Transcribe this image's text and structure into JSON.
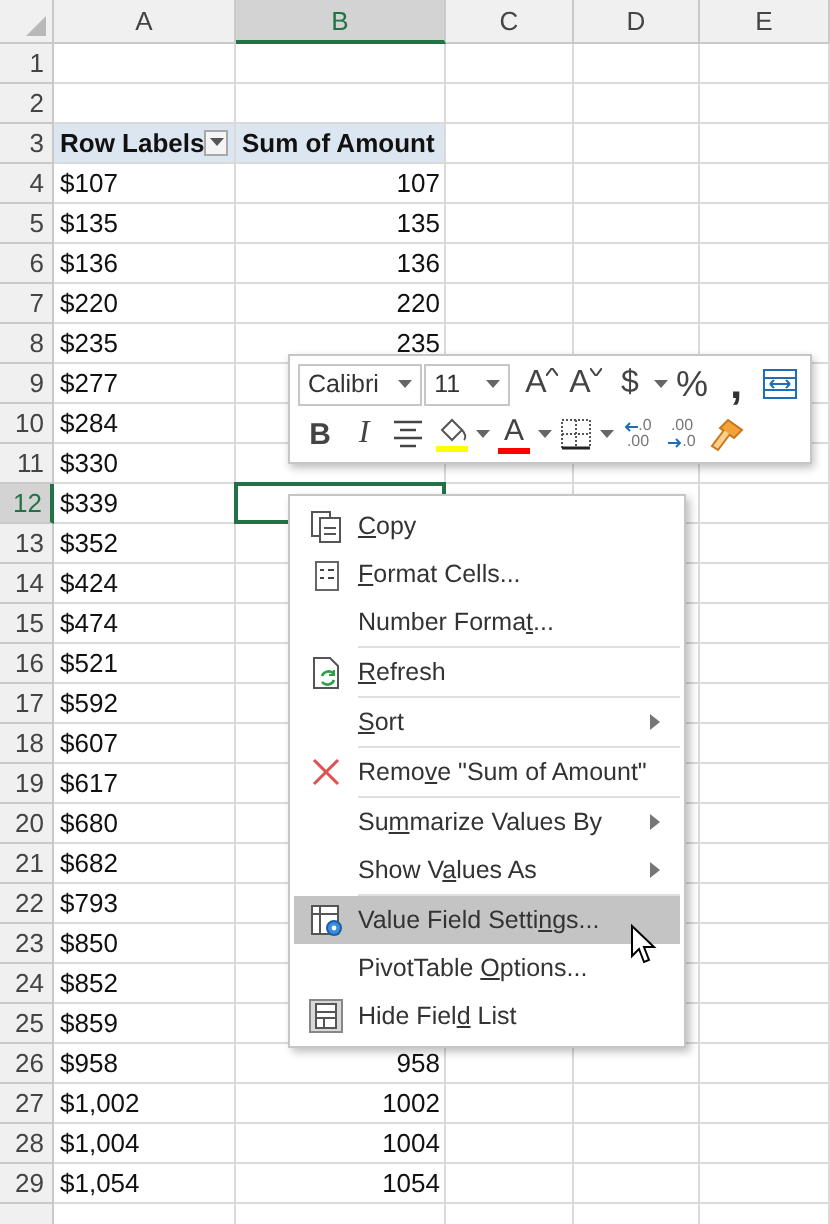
{
  "sheet": {
    "columns": [
      {
        "label": "A",
        "selected": false
      },
      {
        "label": "B",
        "selected": true
      },
      {
        "label": "C",
        "selected": false
      },
      {
        "label": "D",
        "selected": false
      },
      {
        "label": "E",
        "selected": false
      }
    ],
    "rows": [
      {
        "label": "1",
        "selected": false,
        "cells": []
      },
      {
        "label": "2",
        "selected": false,
        "cells": []
      },
      {
        "label": "3",
        "selected": false,
        "kind": "pivot-header",
        "cells": [
          {
            "text": "Row Labels",
            "filter": true
          },
          {
            "text": "Sum of Amount"
          }
        ]
      },
      {
        "label": "4",
        "selected": false,
        "cells": [
          {
            "text": "$107"
          },
          {
            "text": "107",
            "kind": "number"
          }
        ]
      },
      {
        "label": "5",
        "selected": false,
        "cells": [
          {
            "text": "$135"
          },
          {
            "text": "135",
            "kind": "number"
          }
        ]
      },
      {
        "label": "6",
        "selected": false,
        "cells": [
          {
            "text": "$136"
          },
          {
            "text": "136",
            "kind": "number"
          }
        ]
      },
      {
        "label": "7",
        "selected": false,
        "cells": [
          {
            "text": "$220"
          },
          {
            "text": "220",
            "kind": "number"
          }
        ]
      },
      {
        "label": "8",
        "selected": false,
        "cells": [
          {
            "text": "$235"
          },
          {
            "text": "235",
            "kind": "number"
          }
        ]
      },
      {
        "label": "9",
        "selected": false,
        "cells": [
          {
            "text": "$277"
          }
        ]
      },
      {
        "label": "10",
        "selected": false,
        "cells": [
          {
            "text": "$284"
          }
        ]
      },
      {
        "label": "11",
        "selected": false,
        "cells": [
          {
            "text": "$330"
          }
        ]
      },
      {
        "label": "12",
        "selected": true,
        "cells": [
          {
            "text": "$339"
          }
        ]
      },
      {
        "label": "13",
        "selected": false,
        "cells": [
          {
            "text": "$352"
          }
        ]
      },
      {
        "label": "14",
        "selected": false,
        "cells": [
          {
            "text": "$424"
          }
        ]
      },
      {
        "label": "15",
        "selected": false,
        "cells": [
          {
            "text": "$474"
          }
        ]
      },
      {
        "label": "16",
        "selected": false,
        "cells": [
          {
            "text": "$521"
          }
        ]
      },
      {
        "label": "17",
        "selected": false,
        "cells": [
          {
            "text": "$592"
          }
        ]
      },
      {
        "label": "18",
        "selected": false,
        "cells": [
          {
            "text": "$607"
          }
        ]
      },
      {
        "label": "19",
        "selected": false,
        "cells": [
          {
            "text": "$617"
          }
        ]
      },
      {
        "label": "20",
        "selected": false,
        "cells": [
          {
            "text": "$680"
          }
        ]
      },
      {
        "label": "21",
        "selected": false,
        "cells": [
          {
            "text": "$682"
          }
        ]
      },
      {
        "label": "22",
        "selected": false,
        "cells": [
          {
            "text": "$793"
          }
        ]
      },
      {
        "label": "23",
        "selected": false,
        "cells": [
          {
            "text": "$850"
          }
        ]
      },
      {
        "label": "24",
        "selected": false,
        "cells": [
          {
            "text": "$852"
          }
        ]
      },
      {
        "label": "25",
        "selected": false,
        "cells": [
          {
            "text": "$859"
          }
        ]
      },
      {
        "label": "26",
        "selected": false,
        "cells": [
          {
            "text": "$958"
          },
          {
            "text": "958",
            "kind": "number"
          }
        ]
      },
      {
        "label": "27",
        "selected": false,
        "cells": [
          {
            "text": "$1,002"
          },
          {
            "text": "1002",
            "kind": "number"
          }
        ]
      },
      {
        "label": "28",
        "selected": false,
        "cells": [
          {
            "text": "$1,004"
          },
          {
            "text": "1004",
            "kind": "number"
          }
        ]
      },
      {
        "label": "29",
        "selected": false,
        "cells": [
          {
            "text": "$1,054"
          },
          {
            "text": "1054",
            "kind": "number"
          }
        ]
      }
    ]
  },
  "mini_toolbar": {
    "top_tools": [
      {
        "kind": "font-name",
        "value": "Calibri"
      },
      {
        "kind": "font-size",
        "value": "11"
      },
      {
        "kind": "grow-font",
        "text": "A"
      },
      {
        "kind": "shrink-font",
        "text": "A"
      },
      {
        "kind": "currency",
        "text": "$",
        "dropdown": true
      },
      {
        "kind": "percent",
        "text": "%"
      },
      {
        "kind": "comma",
        "text": ","
      },
      {
        "kind": "merge"
      }
    ],
    "bottom_tools": [
      {
        "kind": "bold",
        "text": "B"
      },
      {
        "kind": "italic",
        "text": "I"
      },
      {
        "kind": "center"
      },
      {
        "kind": "fill",
        "color": "#ffff00",
        "dropdown": true
      },
      {
        "kind": "font-color",
        "text": "A",
        "color": "#ff0000",
        "dropdown": true
      },
      {
        "kind": "borders",
        "dropdown": true
      },
      {
        "kind": "increase-decimal",
        "lines": [
          ".0",
          ".00"
        ]
      },
      {
        "kind": "decrease-decimal",
        "lines": [
          ".00",
          ".0"
        ]
      },
      {
        "kind": "format-painter"
      }
    ]
  },
  "context_menu": {
    "items": [
      {
        "label": {
          "key": "C",
          "after": "opy"
        },
        "kind": "copy",
        "selected": false
      },
      {
        "label": {
          "key": "F",
          "after": "ormat Cells..."
        },
        "kind": "format",
        "selected": false
      },
      {
        "label": {
          "before": "Number Forma",
          "key": "t",
          "after": "..."
        },
        "selected": false,
        "separator_after": true
      },
      {
        "label": {
          "key": "R",
          "after": "efresh"
        },
        "kind": "refresh",
        "selected": false,
        "separator_after": true
      },
      {
        "label": {
          "key": "S",
          "after": "ort"
        },
        "submenu": true,
        "selected": false,
        "separator_after": true
      },
      {
        "label": {
          "before": "Remo",
          "key": "v",
          "after": "e \"Sum of Amount\""
        },
        "kind": "remove",
        "selected": false,
        "separator_after": true
      },
      {
        "label": {
          "before": "Su",
          "key": "m",
          "after": "marize Values By"
        },
        "submenu": true,
        "selected": false
      },
      {
        "label": {
          "before": "Show V",
          "key": "a",
          "after": "lues As"
        },
        "submenu": true,
        "selected": false,
        "separator_after": true
      },
      {
        "label": {
          "before": "Value Field Setti",
          "key": "n",
          "after": "gs..."
        },
        "kind": "settings",
        "selected": true
      },
      {
        "label": {
          "before": "PivotTable ",
          "key": "O",
          "after": "ptions..."
        },
        "selected": false
      },
      {
        "label": {
          "before": "Hide Fiel",
          "key": "d",
          "after": " List"
        },
        "kind": "field-list",
        "selected": false
      }
    ]
  }
}
